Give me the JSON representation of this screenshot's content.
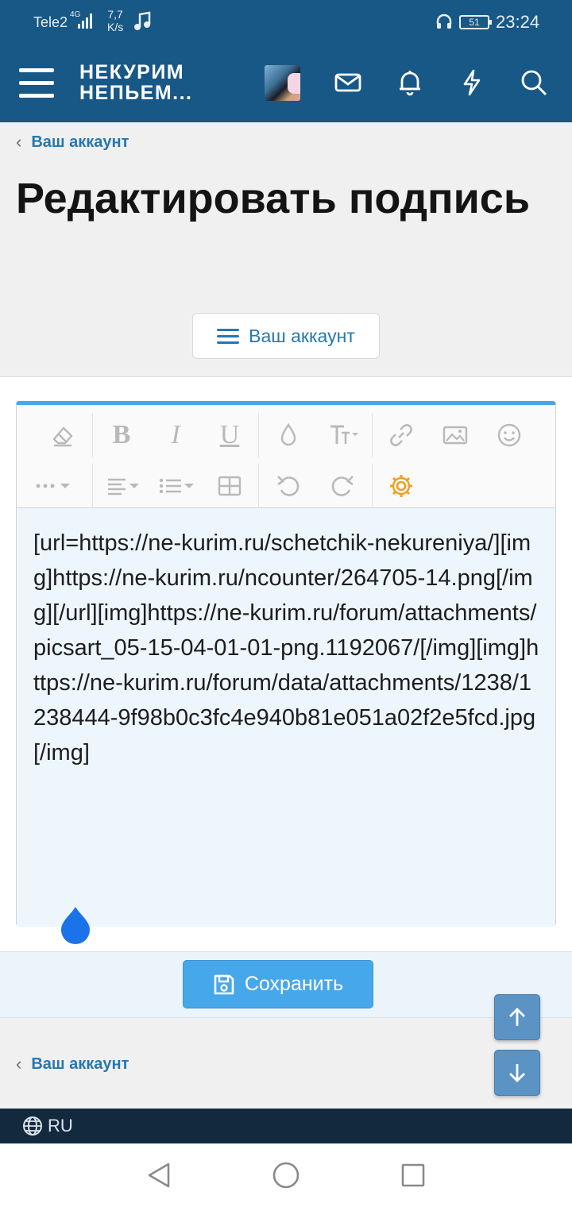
{
  "status_bar": {
    "carrier": "Tele2",
    "network_type": "4G",
    "speed_value": "7,7",
    "speed_unit": "K/s",
    "battery": "51",
    "time": "23:24"
  },
  "header": {
    "logo_line1": "НЕКУРИМ",
    "logo_line2": "НЕПЬЕМ...",
    "icons": [
      "menu-icon",
      "avatar",
      "mail-icon",
      "bell-icon",
      "lightning-icon",
      "search-icon"
    ]
  },
  "breadcrumb": {
    "label": "Ваш аккаунт"
  },
  "page": {
    "title": "Редактировать подпись",
    "account_menu_button": "Ваш аккаунт"
  },
  "editor": {
    "toolbar_row1": [
      "eraser-icon",
      "bold-icon",
      "italic-icon",
      "underline-icon",
      "color-drop-icon",
      "font-size-icon",
      "link-icon",
      "image-icon",
      "smile-icon"
    ],
    "toolbar_row2": [
      "more-icon",
      "align-icon",
      "list-icon",
      "table-icon",
      "undo-icon",
      "redo-icon",
      "settings-icon"
    ],
    "bold_label": "B",
    "italic_label": "I",
    "underline_label": "U",
    "content": "[url=https://ne-kurim.ru/schetchik-nekureniya/][img]https://ne-kurim.ru/ncounter/264705-14.png[/img][/url][img]https://ne-kurim.ru/forum/attachments/picsart_05-15-04-01-01-png.1192067/[/img][img]https://ne-kurim.ru/forum/data/attachments/1238/1238444-9f98b0c3fc4e940b81e051a02f2e5fcd.jpg[/img]"
  },
  "save_button": {
    "label": "Сохранить"
  },
  "footer_breadcrumb": {
    "label": "Ваш аккаунт"
  },
  "footer": {
    "language": "RU"
  },
  "colors": {
    "header_bg": "#185886",
    "link": "#2577b1",
    "accent": "#47a7eb",
    "settings_icon": "#f0a020"
  }
}
